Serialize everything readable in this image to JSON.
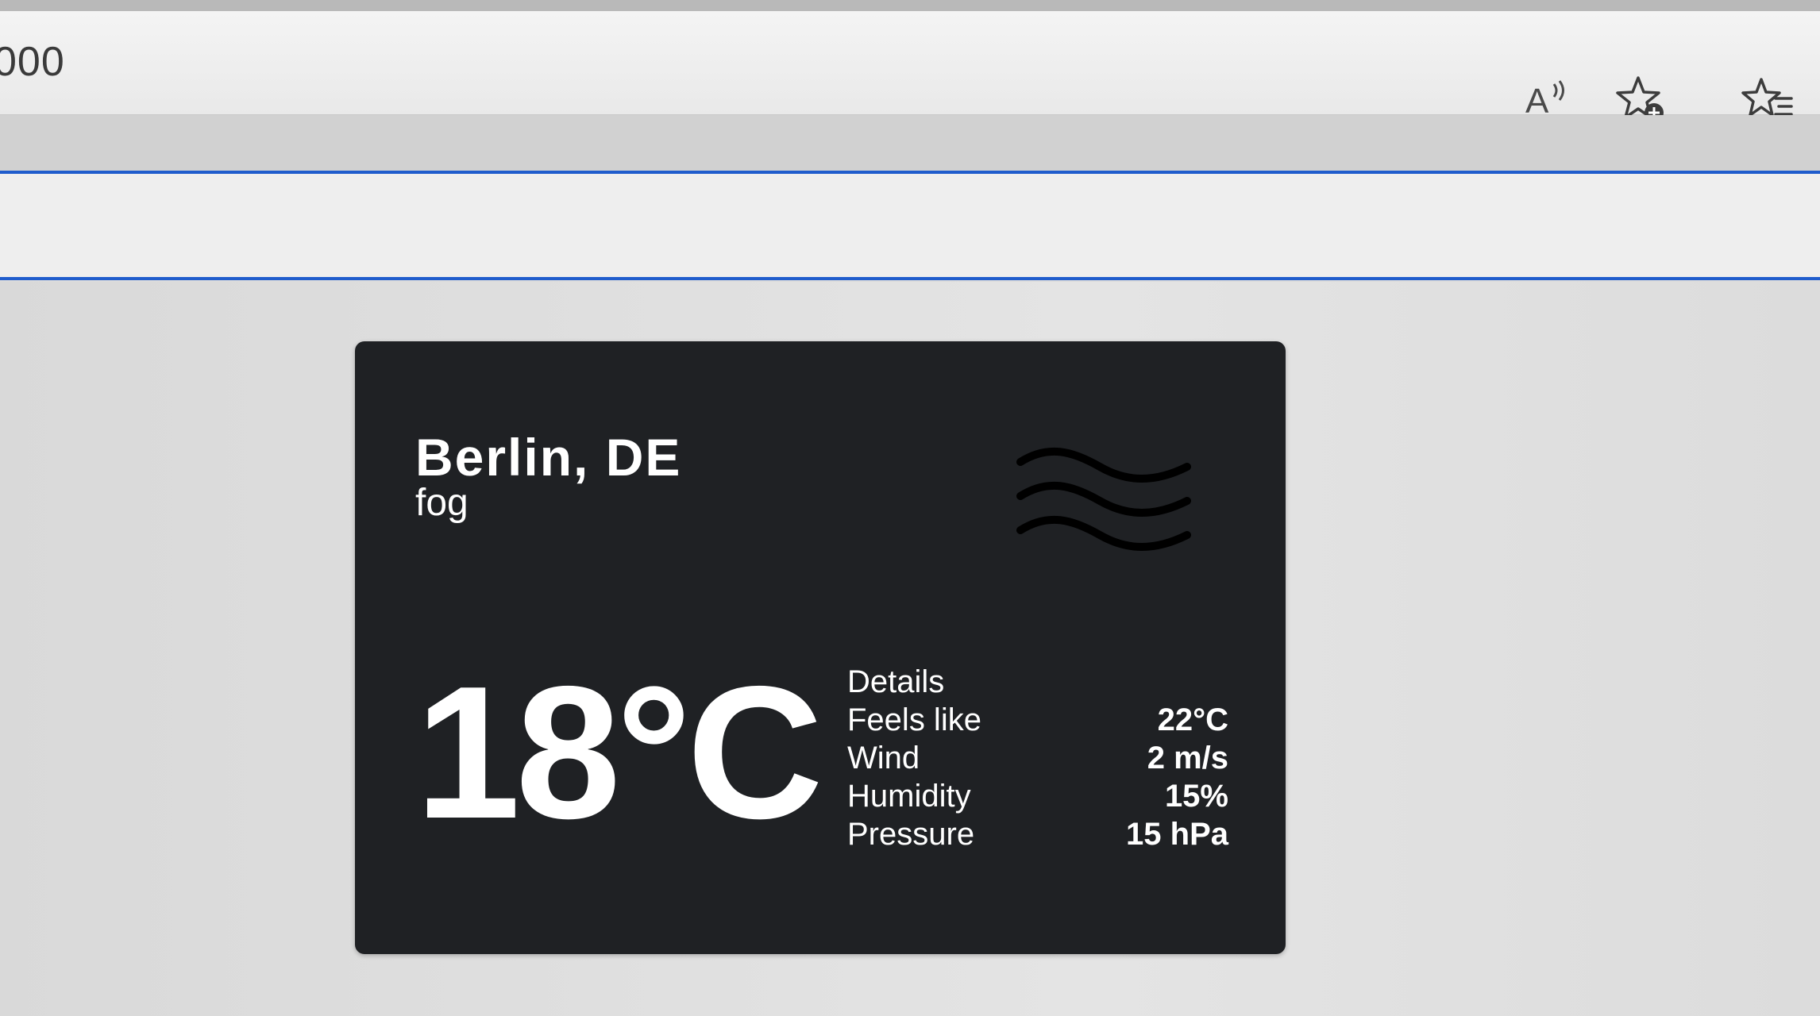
{
  "browser": {
    "url_fragment": "000",
    "icons": [
      "read-aloud-icon",
      "add-favorite-icon",
      "favorites-icon"
    ]
  },
  "weather": {
    "city": "Berlin, DE",
    "condition": "fog",
    "condition_icon": "fog-icon",
    "temperature": "18°C",
    "details_header": "Details",
    "details": [
      {
        "label": "Feels like",
        "value": "22°C"
      },
      {
        "label": "Wind",
        "value": "2 m/s"
      },
      {
        "label": "Humidity",
        "value": "15%"
      },
      {
        "label": "Pressure",
        "value": "15 hPa"
      }
    ]
  },
  "colors": {
    "card_background": "#1f2124",
    "text": "#ffffff",
    "accent_border": "#1f5ccc"
  }
}
